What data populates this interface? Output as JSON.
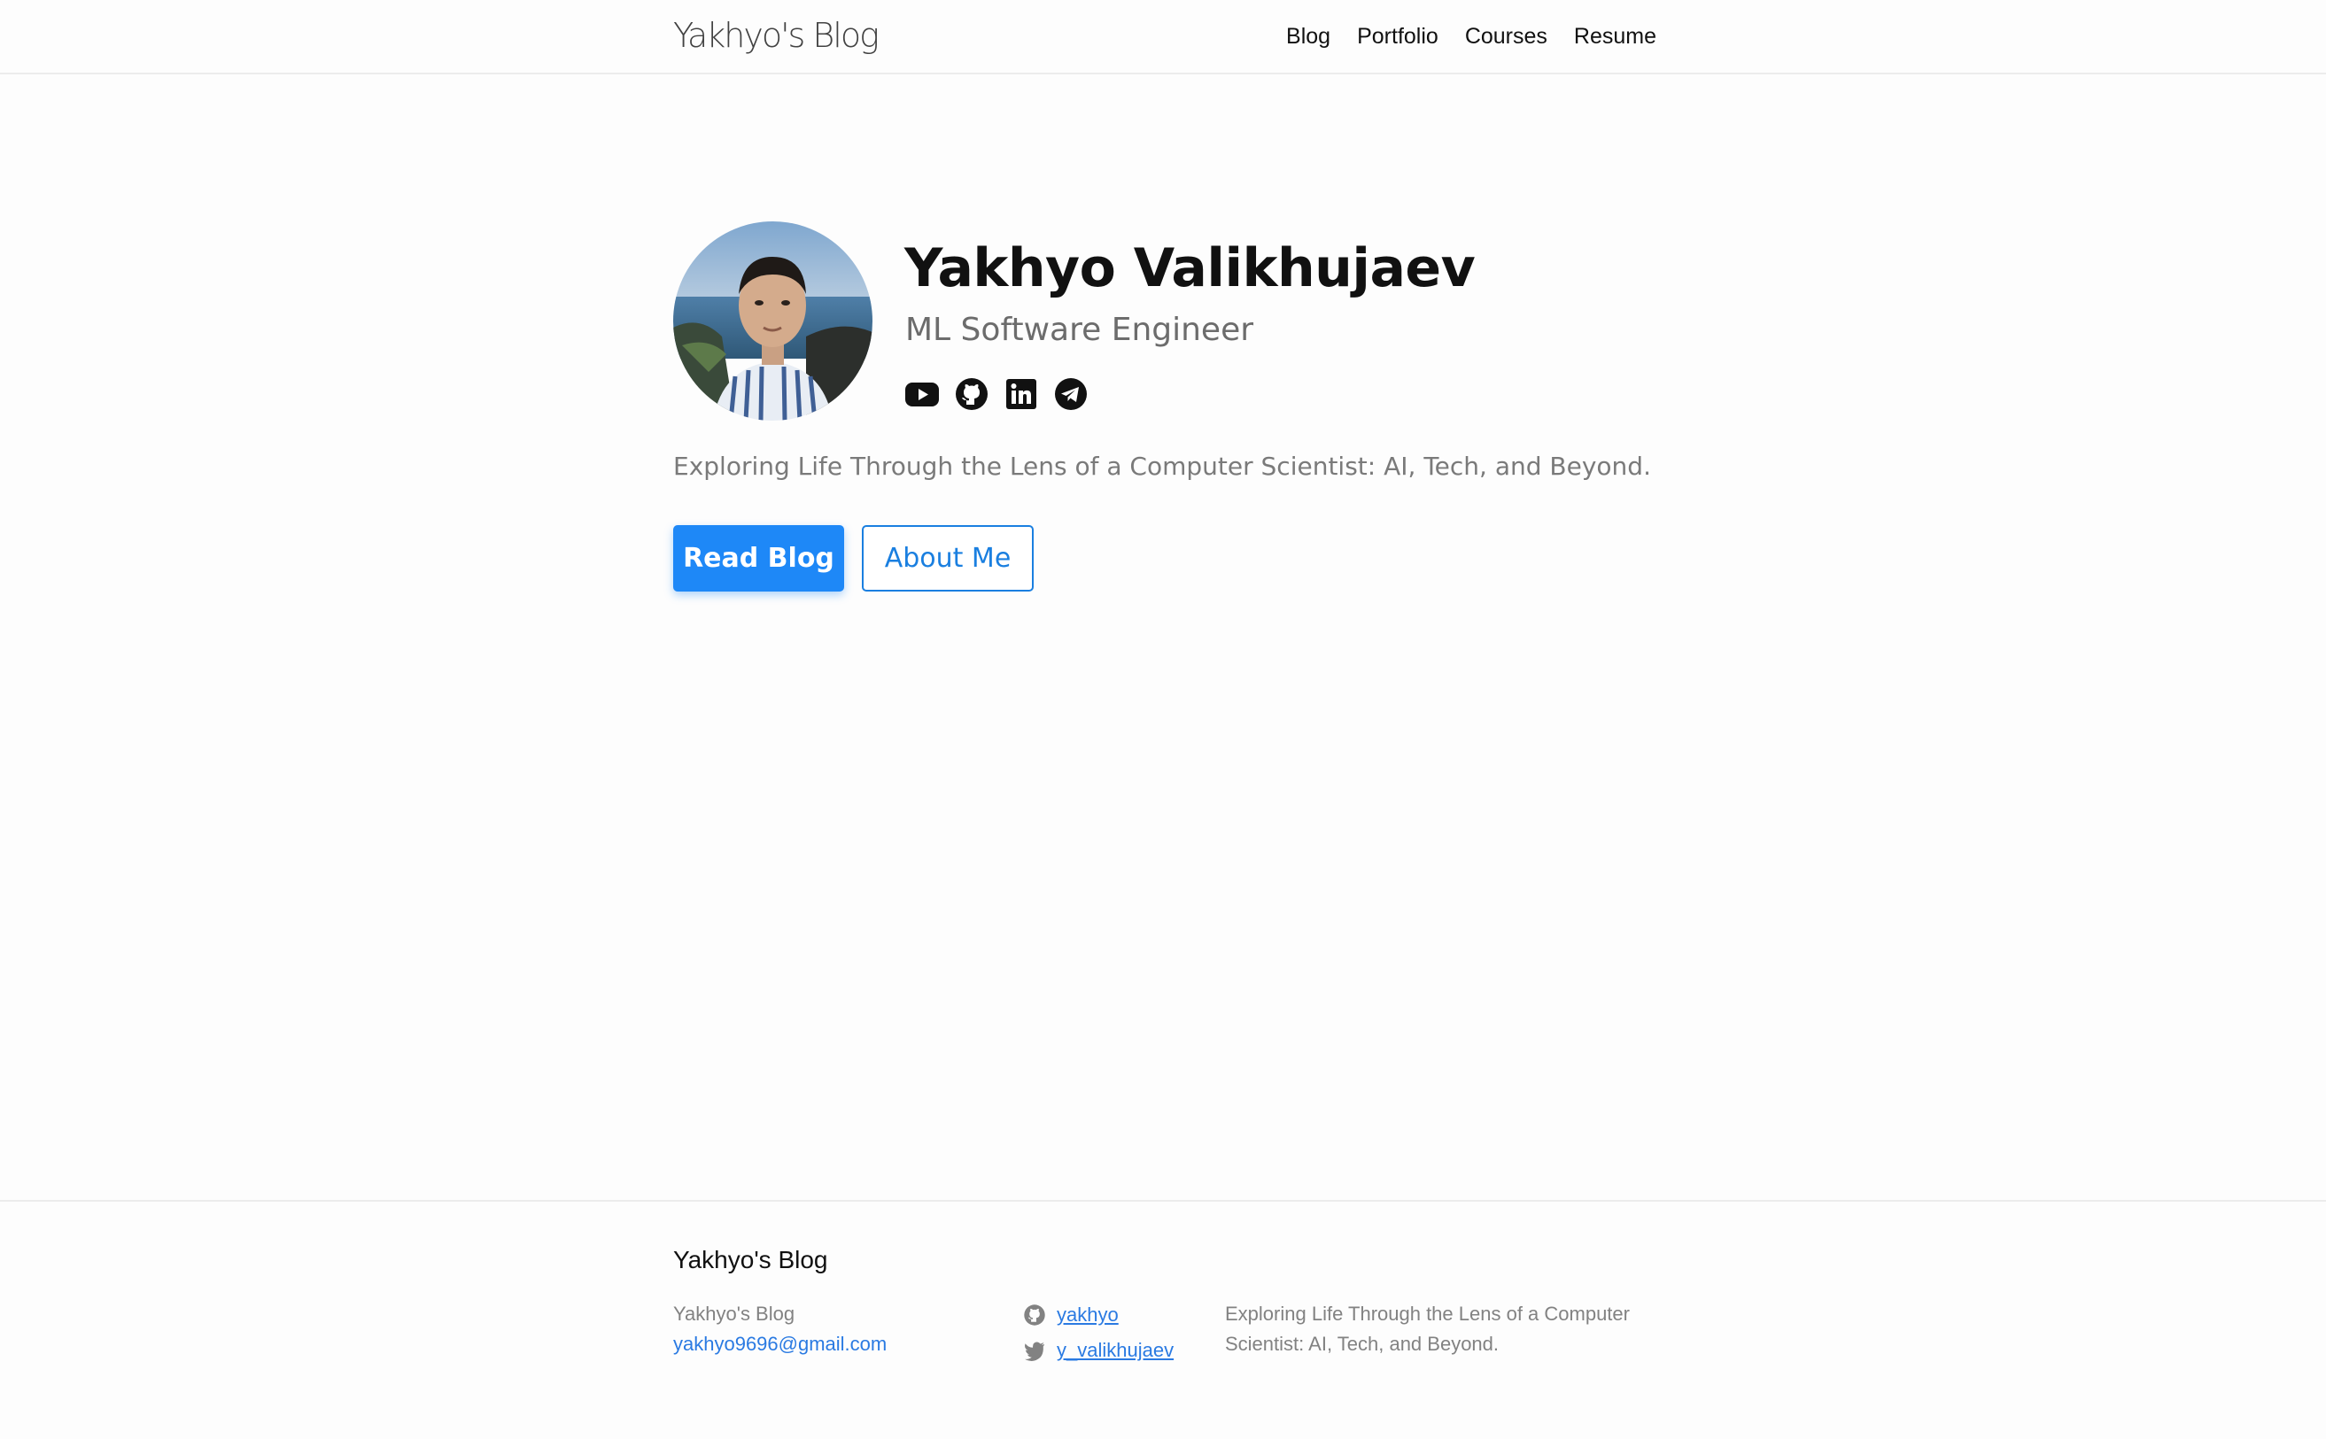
{
  "header": {
    "site_title": "Yakhyo's Blog",
    "nav": [
      {
        "label": "Blog"
      },
      {
        "label": "Portfolio"
      },
      {
        "label": "Courses"
      },
      {
        "label": "Resume"
      }
    ]
  },
  "hero": {
    "avatar_alt": "Profile photo",
    "name": "Yakhyo Valikhujaev",
    "role": "ML Software Engineer",
    "social_icons": [
      "youtube-icon",
      "github-icon",
      "linkedin-icon",
      "telegram-icon"
    ],
    "tagline": "Exploring Life Through the Lens of a Computer Scientist: AI, Tech, and Beyond.",
    "primary_button": "Read Blog",
    "secondary_button": "About Me"
  },
  "footer": {
    "heading": "Yakhyo's Blog",
    "name": "Yakhyo's Blog",
    "email": "yakhyo9696@gmail.com",
    "github_user": "yakhyo",
    "twitter_user": "y_valikhujaev",
    "description": "Exploring Life Through the Lens of a Computer Scientist: AI, Tech, and Beyond."
  },
  "colors": {
    "accent": "#1e88f7",
    "link": "#2a7ae2",
    "muted_text": "#828282"
  }
}
